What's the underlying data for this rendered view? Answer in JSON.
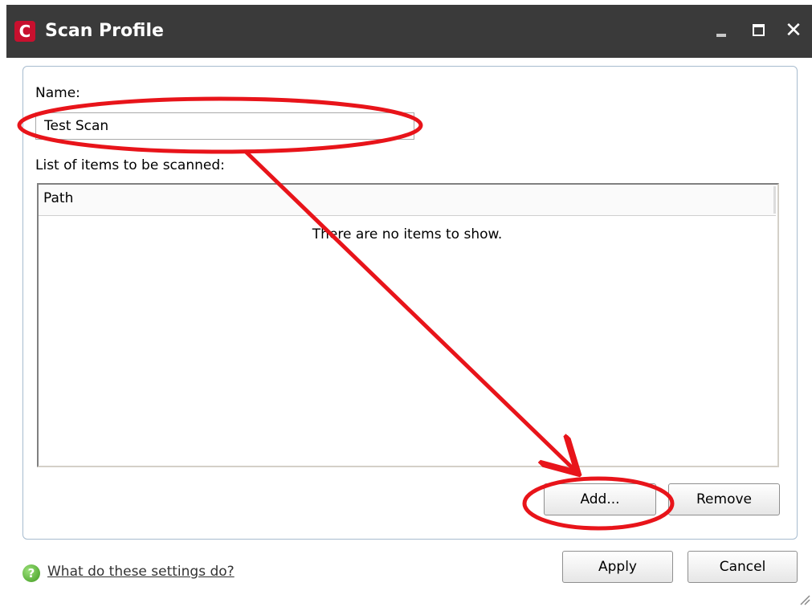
{
  "window": {
    "title": "Scan Profile",
    "logo_letter": "C",
    "close_glyph": "✕"
  },
  "form": {
    "name_label": "Name:",
    "name_value": "Test Scan",
    "list_label": "List of items to be scanned:"
  },
  "list": {
    "columns": [
      "Path"
    ],
    "empty_message": "There are no items to show."
  },
  "buttons": {
    "add": "Add...",
    "remove": "Remove",
    "apply": "Apply",
    "cancel": "Cancel"
  },
  "footer": {
    "help_icon": "?",
    "help_link": "What do these settings do?"
  },
  "colors": {
    "titlebar": "#3a3a3a",
    "brand": "#c8102e",
    "annotation": "#e8141a",
    "panel_border": "#a7bccf"
  },
  "icons": [
    "app-logo-icon",
    "minimize-icon",
    "maximize-icon",
    "close-icon",
    "help-icon",
    "resize-grip-icon"
  ]
}
